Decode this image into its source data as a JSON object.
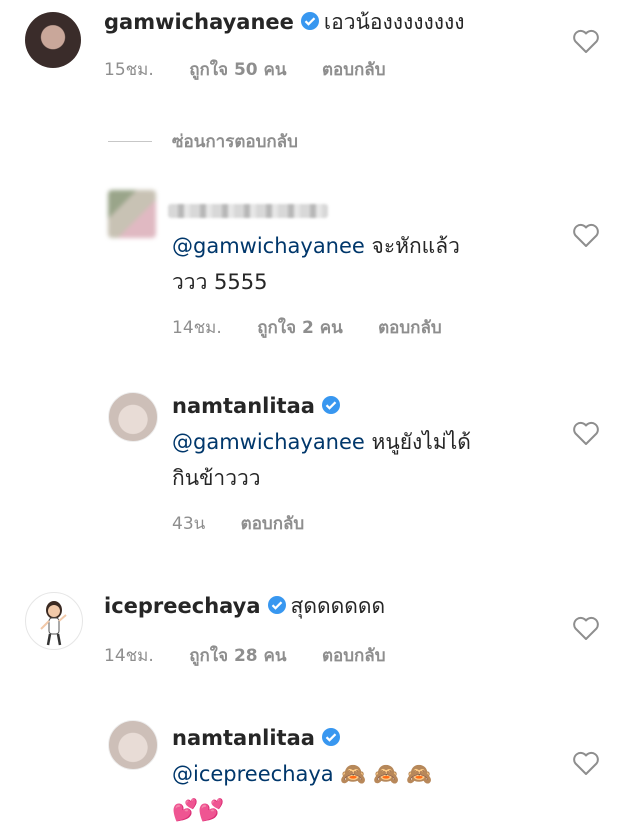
{
  "comments": [
    {
      "username": "gamwichayanee",
      "text": "เอวน้องงงงงงงง",
      "time": "15ชม.",
      "likes": "ถูกใจ 50 คน",
      "reply": "ตอบกลับ"
    },
    {
      "username": "",
      "mention": "@gamwichayanee",
      "text_line1": "จะหักแล้ว",
      "text_line2": "ววว 5555",
      "time": "14ชม.",
      "likes": "ถูกใจ 2 คน",
      "reply": "ตอบกลับ"
    },
    {
      "username": "namtanlitaa",
      "mention": "@gamwichayanee",
      "text_line1": "หนูยังไม่ได้",
      "text_line2": "กินข้าววว",
      "time": "43น",
      "reply": "ตอบกลับ"
    },
    {
      "username": "icepreechaya",
      "text": "สุดดดดดด",
      "time": "14ชม.",
      "likes": "ถูกใจ 28 คน",
      "reply": "ตอบกลับ"
    },
    {
      "username": "namtanlitaa",
      "mention": "@icepreechaya",
      "emoji_line1": "🙈 🙈 🙈",
      "emoji_line2": "💕💕"
    }
  ],
  "hide_replies": "ซ่อนการตอบกลับ",
  "colors": {
    "mention": "#00376b",
    "meta": "#8e8e8e",
    "verified": "#3897f0"
  },
  "icons": [
    "verified-badge-icon",
    "heart-icon"
  ]
}
